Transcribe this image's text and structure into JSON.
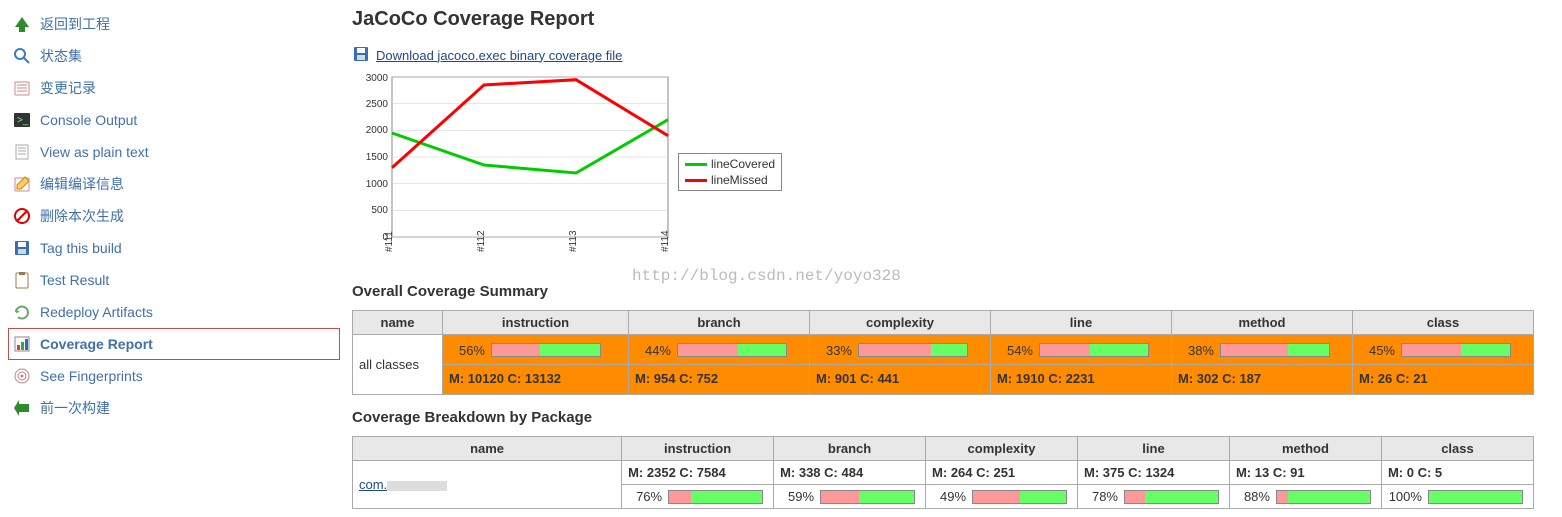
{
  "sidebar": {
    "items": [
      {
        "label": "返回到工程"
      },
      {
        "label": "状态集"
      },
      {
        "label": "变更记录"
      },
      {
        "label": "Console Output"
      },
      {
        "label": "View as plain text"
      },
      {
        "label": "编辑编译信息"
      },
      {
        "label": "删除本次生成"
      },
      {
        "label": "Tag this build"
      },
      {
        "label": "Test Result"
      },
      {
        "label": "Redeploy Artifacts"
      },
      {
        "label": "Coverage Report"
      },
      {
        "label": "See Fingerprints"
      },
      {
        "label": "前一次构建"
      }
    ]
  },
  "page": {
    "title": "JaCoCo Coverage Report",
    "download_link": "Download jacoco.exec binary coverage file",
    "watermark": "http://blog.csdn.net/yoyo328",
    "overall_heading": "Overall Coverage Summary",
    "breakdown_heading": "Coverage Breakdown by Package"
  },
  "chart_data": {
    "type": "line",
    "x": [
      "#111",
      "#112",
      "#113",
      "#114"
    ],
    "series": [
      {
        "name": "lineCovered",
        "color": "#00cc00",
        "values": [
          1950,
          1350,
          1200,
          2200
        ]
      },
      {
        "name": "lineMissed",
        "color": "#ff0000",
        "values": [
          1300,
          2850,
          2950,
          1900
        ]
      }
    ],
    "ylim": [
      0,
      3000
    ],
    "yticks": [
      0,
      500,
      1000,
      1500,
      2000,
      2500,
      3000
    ]
  },
  "overall": {
    "headers": [
      "name",
      "instruction",
      "branch",
      "complexity",
      "line",
      "method",
      "class"
    ],
    "row_name": "all classes",
    "metrics": {
      "instruction": {
        "pct": "56%",
        "missed": 10120,
        "covered": 13132
      },
      "branch": {
        "pct": "44%",
        "missed": 954,
        "covered": 752
      },
      "complexity": {
        "pct": "33%",
        "missed": 901,
        "covered": 441
      },
      "line": {
        "pct": "54%",
        "missed": 1910,
        "covered": 2231
      },
      "method": {
        "pct": "38%",
        "missed": 302,
        "covered": 187
      },
      "class": {
        "pct": "45%",
        "missed": 26,
        "covered": 21
      }
    }
  },
  "breakdown": {
    "headers": [
      "name",
      "instruction",
      "branch",
      "complexity",
      "line",
      "method",
      "class"
    ],
    "rows": [
      {
        "name": "com.",
        "instruction": {
          "pct": "76%",
          "missed": 2352,
          "covered": 7584
        },
        "branch": {
          "pct": "59%",
          "missed": 338,
          "covered": 484
        },
        "complexity": {
          "pct": "49%",
          "missed": 264,
          "covered": 251
        },
        "line": {
          "pct": "78%",
          "missed": 375,
          "covered": 1324
        },
        "method": {
          "pct": "88%",
          "missed": 13,
          "covered": 91
        },
        "class": {
          "pct": "100%",
          "missed": 0,
          "covered": 5
        }
      }
    ]
  }
}
